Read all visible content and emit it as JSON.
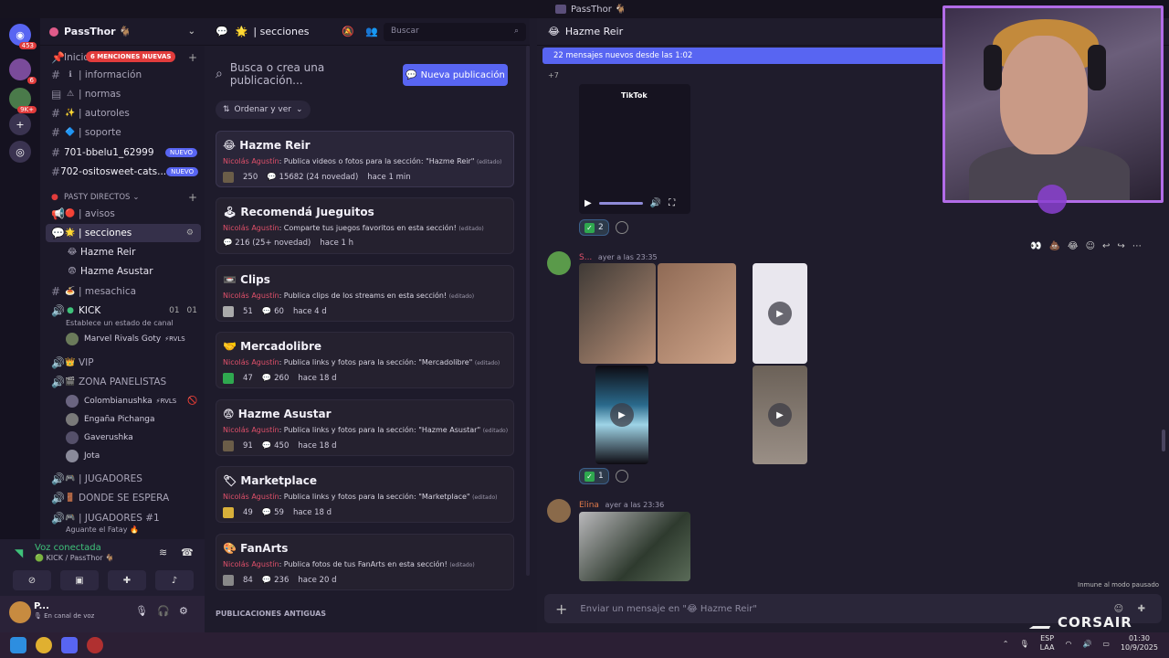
{
  "window": {
    "title": "PassThor 🐐"
  },
  "rail": {
    "badges": [
      "453",
      "6",
      "9K+"
    ]
  },
  "guild": {
    "name": "PassThor 🐐",
    "mentions_pill": "6 MENCIONES NUEVAS",
    "first_channel_partial": "Inicio"
  },
  "channels": [
    {
      "label": "| información",
      "emoji": "ℹ"
    },
    {
      "label": "| normas",
      "emoji": "⚠"
    },
    {
      "label": "| autoroles",
      "emoji": "✨"
    },
    {
      "label": "| soporte",
      "emoji": "🔷"
    },
    {
      "label": "701-bbelu1_62999",
      "pill": "NUEVO"
    },
    {
      "label": "702-ositosweet-cats...",
      "pill": "NUEVO"
    }
  ],
  "category_directos": "PASTY DIRECTOS",
  "directos_channels": [
    {
      "label": "| avisos",
      "emoji": "🔴"
    },
    {
      "label": "| secciones",
      "emoji": "🌟"
    },
    {
      "label": "Hazme Reir",
      "emoji": "😂"
    },
    {
      "label": "Hazme Asustar",
      "emoji": "😨"
    },
    {
      "label": "| mesachica",
      "emoji": "🍝"
    }
  ],
  "voice_kick": {
    "label": "KICK",
    "counts": [
      "01",
      "01"
    ],
    "status_hint": "Establece un estado de canal",
    "users": [
      {
        "name": "Marvel Rivals Goty",
        "tag": "⚡RVLS"
      }
    ]
  },
  "voice_vip": {
    "label": "VIP",
    "emoji": "👑"
  },
  "voice_zona": {
    "label": "ZONA PANELISTAS",
    "emoji": "🎬",
    "users": [
      {
        "name": "Colombianushka",
        "tag": "⚡RVLS"
      },
      {
        "name": "Engaña Pichanga",
        "tag": ""
      },
      {
        "name": "Gaverushka",
        "tag": ""
      },
      {
        "name": "Jota",
        "tag": ""
      }
    ]
  },
  "voice_more": [
    {
      "label": "| JUGADORES",
      "emoji": "🎮"
    },
    {
      "label": "DONDE SE ESPERA",
      "emoji": "🚪"
    },
    {
      "label": "| JUGADORES #1",
      "emoji": "🎮"
    }
  ],
  "voice_more_sub": "Aguante el Fatay 🔥",
  "voice_panel": {
    "title": "Voz conectada",
    "sub": "🟢 KICK / PassThor 🐐"
  },
  "user": {
    "name": "P...",
    "status": "🎙 En canal de voz"
  },
  "forum": {
    "channel": "| secciones",
    "header_search_placeholder": "Buscar",
    "search_placeholder": "Busca o crea una publicación...",
    "new_post_label": "Nueva publicación",
    "sort_label": "Ordenar y ver",
    "old_posts_label": "PUBLICACIONES ANTIGUAS",
    "posts": [
      {
        "emoji": "😂",
        "title": "Hazme Reir",
        "author": "Nicolás Agustín",
        "desc": ": Publica videos o fotos para la sección: \"Hazme Reir\"",
        "edited": "(editado)",
        "count1": "250",
        "count2": "15682 (24 novedad)",
        "time": "hace 1 min"
      },
      {
        "emoji": "🕹",
        "title": "Recomendá Jueguitos",
        "author": "Nicolás Agustín",
        "desc": ": Comparte tus juegos favoritos en esta sección!",
        "edited": "(editado)",
        "count1": "",
        "count2": "216 (25+ novedad)",
        "time": "hace 1 h"
      },
      {
        "emoji": "📼",
        "title": "Clips",
        "author": "Nicolás Agustín",
        "desc": ": Publica clips de los streams en esta sección!",
        "edited": "(editado)",
        "count1": "51",
        "count2": "60",
        "time": "hace 4 d"
      },
      {
        "emoji": "🤝",
        "title": "Mercadolibre",
        "author": "Nicolás Agustín",
        "desc": ": Publica links y fotos para la sección: \"Mercadolibre\"",
        "edited": "(editado)",
        "count1": "47",
        "count2": "260",
        "time": "hace 18 d"
      },
      {
        "emoji": "😨",
        "title": "Hazme Asustar",
        "author": "Nicolás Agustín",
        "desc": ": Publica links y fotos para la sección: \"Hazme Asustar\"",
        "edited": "(editado)",
        "count1": "91",
        "count2": "450",
        "time": "hace 18 d"
      },
      {
        "emoji": "🏷",
        "title": "Marketplace",
        "author": "Nicolás Agustín",
        "desc": ": Publica links y fotos para la sección: \"Marketplace\"",
        "edited": "(editado)",
        "count1": "49",
        "count2": "59",
        "time": "hace 18 d"
      },
      {
        "emoji": "🎨",
        "title": "FanArts",
        "author": "Nicolás Agustín",
        "desc": ": Publica fotos de tus FanArts en esta sección!",
        "edited": "(editado)",
        "count1": "84",
        "count2": "236",
        "time": "hace 20 d"
      }
    ]
  },
  "thread": {
    "title": "Hazme Reir",
    "emoji": "😂",
    "new_messages": "22 mensajes nuevos desde las 1:02",
    "more": "+7",
    "video_brand": "TikTok",
    "reactions": [
      {
        "count": "2"
      },
      {
        "count": "1"
      }
    ],
    "msg1_author": "S...",
    "msg1_time": "ayer a las 23:35",
    "msg2_author": "Elina",
    "msg2_time": "ayer a las 23:36",
    "immune_note": "Inmune al modo pausado",
    "composer_placeholder": "Enviar un mensaje en \"😂 Hazme Reir\""
  },
  "overlay": {
    "brand": "CORSAIR"
  },
  "taskbar": {
    "lang1": "ESP",
    "lang2": "LAA",
    "time": "01:30",
    "date": "10/9/2025"
  },
  "colors": {
    "accent": "#5865f2",
    "mention": "#e23c3c",
    "online": "#3fc27a",
    "webcam_border": "#b26ce8"
  }
}
